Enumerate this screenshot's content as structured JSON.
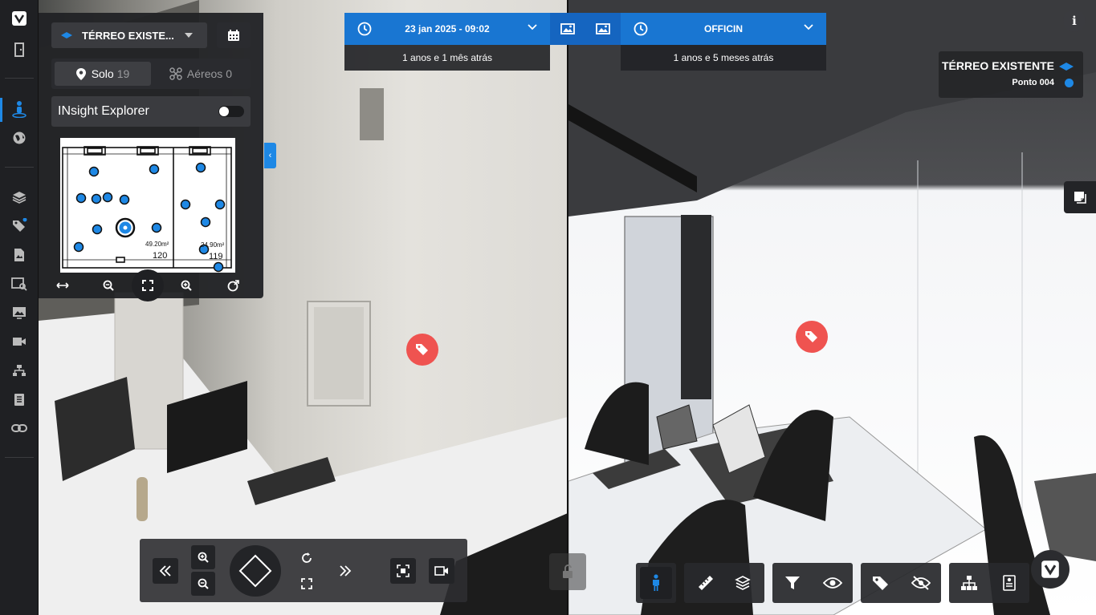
{
  "panel": {
    "floor_name": "TÉRREO EXISTE...",
    "solo_label": "Solo",
    "solo_count": "19",
    "aereos_label": "Aéreos",
    "aereos_count": "0",
    "explorer_label": "INsight Explorer",
    "explorer_enabled": false,
    "area_left": "49.20m²",
    "area_right": "24.90m²",
    "room_left": "120",
    "room_right": "119"
  },
  "left_capture": {
    "date": "23 jan 2025 - 09:02",
    "relative": "1 anos e 1 mês atrás"
  },
  "right_capture": {
    "model": "OFFICIN",
    "relative": "1 anos e 5 meses atrás"
  },
  "location": {
    "floor": "TÉRREO EXISTENTE",
    "point": "Ponto 004"
  },
  "colors": {
    "accent": "#1e88e5",
    "tag": "#ef5350",
    "panel": "#212225"
  }
}
